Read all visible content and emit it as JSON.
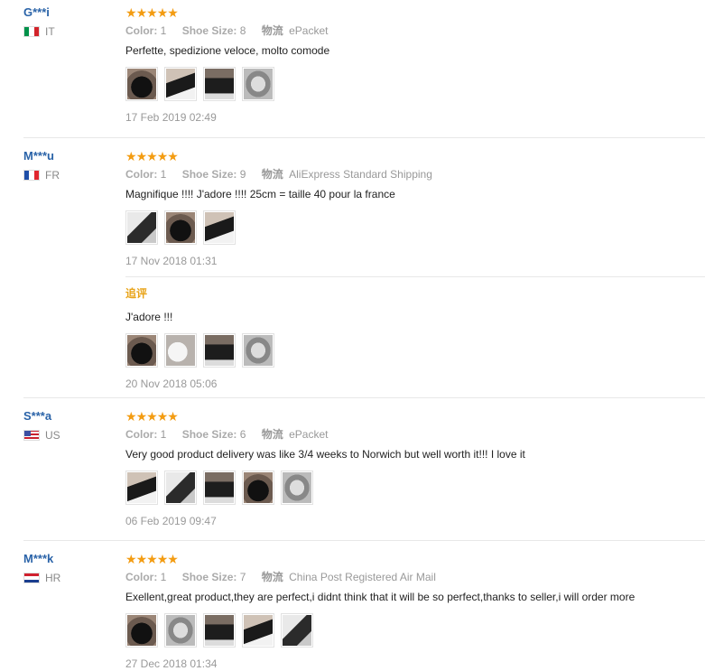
{
  "colors": {
    "username": "#2a63a8",
    "star": "#f39c12",
    "append": "#e8a317"
  },
  "labels": {
    "color": "Color:",
    "shoe_size": "Shoe Size:",
    "shipping": "物流"
  },
  "reviews": [
    {
      "user": "G***i",
      "country": "IT",
      "stars": 5,
      "color_value": "1",
      "size_value": "8",
      "shipping_value": "ePacket",
      "text": "Perfette, spedizione veloce, molto comode",
      "photos": [
        "photo-1",
        "photo-2",
        "photo-3",
        "photo-4"
      ],
      "date": "17 Feb 2019 02:49"
    },
    {
      "user": "M***u",
      "country": "FR",
      "stars": 5,
      "color_value": "1",
      "size_value": "9",
      "shipping_value": "AliExpress Standard Shipping",
      "text": "Magnifique !!!! J'adore !!!! 25cm = taille 40 pour la france",
      "photos": [
        "photo-1",
        "photo-2",
        "photo-3"
      ],
      "date": "17 Nov 2018 01:31",
      "append": {
        "label": "追评",
        "text": "J'adore !!!",
        "photos": [
          "photo-1",
          "photo-2",
          "photo-3",
          "photo-4"
        ],
        "date": "20 Nov 2018 05:06"
      }
    },
    {
      "user": "S***a",
      "country": "US",
      "stars": 5,
      "color_value": "1",
      "size_value": "6",
      "shipping_value": "ePacket",
      "text": "Very good product delivery was like 3/4 weeks to Norwich but well worth it!!! I love it",
      "photos": [
        "photo-1",
        "photo-2",
        "photo-3",
        "photo-4",
        "photo-5"
      ],
      "date": "06 Feb 2019 09:47"
    },
    {
      "user": "M***k",
      "country": "HR",
      "stars": 5,
      "color_value": "1",
      "size_value": "7",
      "shipping_value": "China Post Registered Air Mail",
      "text": "Exellent,great product,they are perfect,i didnt think that it will be so perfect,thanks to seller,i will order more",
      "photos": [
        "photo-1",
        "photo-2",
        "photo-3",
        "photo-4",
        "photo-5"
      ],
      "date": "27 Dec 2018 01:34"
    }
  ]
}
